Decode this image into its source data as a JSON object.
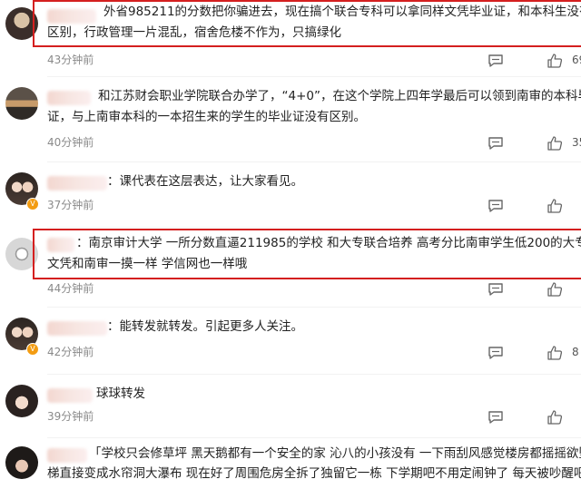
{
  "comments": [
    {
      "text_line1": "外省985211的分数把你骗进去，现在搞个联合专科可以拿同样文凭毕业证，和本科生没有任",
      "text_line2": "区别，行政管理一片混乱，宿舍危楼不作为，只搞绿化",
      "time": "43分钟前",
      "likes": "69",
      "highlighted": true
    },
    {
      "text_line1": "和江苏财会职业学院联合办学了，“4+0”，在这个学院上四年学最后可以领到南审的本科毕业",
      "text_line2": "证，与上南审本科的一本招生来的学生的毕业证没有区别。",
      "time": "40分钟前",
      "likes": "35"
    },
    {
      "text_line1": "：课代表在这层表达，让大家看见。",
      "time": "37分钟前",
      "likes": ""
    },
    {
      "text_line1": "：南京审计大学 一所分数直逼211985的学校 和大专联合培养 高考分比南审学生低200的大专生拿",
      "text_line2": "文凭和南审一摸一样 学信网也一样哦",
      "time": "44分钟前",
      "likes": "",
      "highlighted": true
    },
    {
      "text_line1": "：能转发就转发。引起更多人关注。",
      "time": "42分钟前",
      "likes": "8"
    },
    {
      "text_line1": "球球转发",
      "time": "39分钟前",
      "likes": ""
    },
    {
      "text_line1": "「学校只会修草坪 黑天鹅都有一个安全的家 沁八的小孩没有 一下雨刮风感觉楼房都摇摇欲坠 楼",
      "text_line2": "梯直接变成水帘洞大瀑布 现在好了周围危房全拆了独留它一栋 下学期吧不用定闹钟了 每天被吵醒吧等着"
    }
  ],
  "icons": {
    "reply": "comment-icon",
    "like": "thumbs-up-icon"
  },
  "colors": {
    "highlight": "#d41f1f",
    "time": "#8a8a8a"
  }
}
